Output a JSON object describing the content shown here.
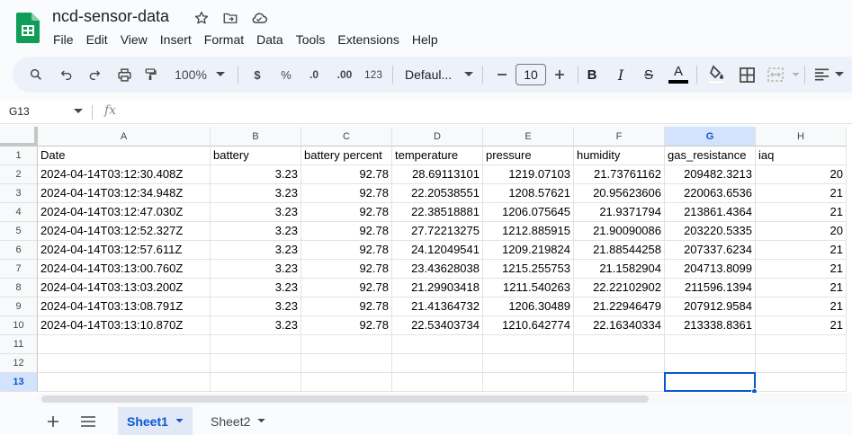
{
  "app": {
    "doc_title": "ncd-sensor-data",
    "title_icons": [
      "star-icon",
      "move-to-folder-icon",
      "cloud-status-icon"
    ],
    "brand_color": "#0f9d58"
  },
  "menu": [
    "File",
    "Edit",
    "View",
    "Insert",
    "Format",
    "Data",
    "Tools",
    "Extensions",
    "Help"
  ],
  "toolbar": {
    "zoom": "100%",
    "currency": "$",
    "percent": "%",
    "decrease_decimal": ".0",
    "increase_decimal": ".00",
    "number_format": "123",
    "font": "Defaul...",
    "font_size": "10",
    "bold": "B",
    "italic": "I",
    "strikethrough": "S",
    "text_color_letter": "A",
    "text_color": "#000000"
  },
  "formula_bar": {
    "name_box": "G13",
    "fx": "fx",
    "value": ""
  },
  "grid": {
    "selected_cell": "G13",
    "selected_column": "G",
    "selected_row": "13",
    "columns": [
      "A",
      "B",
      "C",
      "D",
      "E",
      "F",
      "G",
      "H"
    ],
    "row_numbers": [
      "1",
      "2",
      "3",
      "4",
      "5",
      "6",
      "7",
      "8",
      "9",
      "10",
      "11",
      "12",
      "13"
    ],
    "header": [
      "Date",
      "battery",
      "battery percent",
      "temperature",
      "pressure",
      "humidity",
      "gas_resistance",
      "iaq"
    ],
    "rows": [
      [
        "2024-04-14T03:12:30.408Z",
        "3.23",
        "92.78",
        "28.69113101",
        "1219.07103",
        "21.73761162",
        "209482.3213",
        "20"
      ],
      [
        "2024-04-14T03:12:34.948Z",
        "3.23",
        "92.78",
        "22.20538551",
        "1208.57621",
        "20.95623606",
        "220063.6536",
        "21"
      ],
      [
        "2024-04-14T03:12:47.030Z",
        "3.23",
        "92.78",
        "22.38518881",
        "1206.075645",
        "21.9371794",
        "213861.4364",
        "21"
      ],
      [
        "2024-04-14T03:12:52.327Z",
        "3.23",
        "92.78",
        "27.72213275",
        "1212.885915",
        "21.90090086",
        "203220.5335",
        "20"
      ],
      [
        "2024-04-14T03:12:57.611Z",
        "3.23",
        "92.78",
        "24.12049541",
        "1209.219824",
        "21.88544258",
        "207337.6234",
        "21"
      ],
      [
        "2024-04-14T03:13:00.760Z",
        "3.23",
        "92.78",
        "23.43628038",
        "1215.255753",
        "21.1582904",
        "204713.8099",
        "21"
      ],
      [
        "2024-04-14T03:13:03.200Z",
        "3.23",
        "92.78",
        "21.29903418",
        "1211.540263",
        "22.22102902",
        "211596.1394",
        "21"
      ],
      [
        "2024-04-14T03:13:08.791Z",
        "3.23",
        "92.78",
        "21.41364732",
        "1206.30489",
        "21.22946479",
        "207912.9584",
        "21"
      ],
      [
        "2024-04-14T03:13:10.870Z",
        "3.23",
        "92.78",
        "22.53403734",
        "1210.642774",
        "22.16340334",
        "213338.8361",
        "21"
      ]
    ]
  },
  "sheets": {
    "tabs": [
      {
        "label": "Sheet1",
        "active": true
      },
      {
        "label": "Sheet2",
        "active": false
      }
    ]
  }
}
